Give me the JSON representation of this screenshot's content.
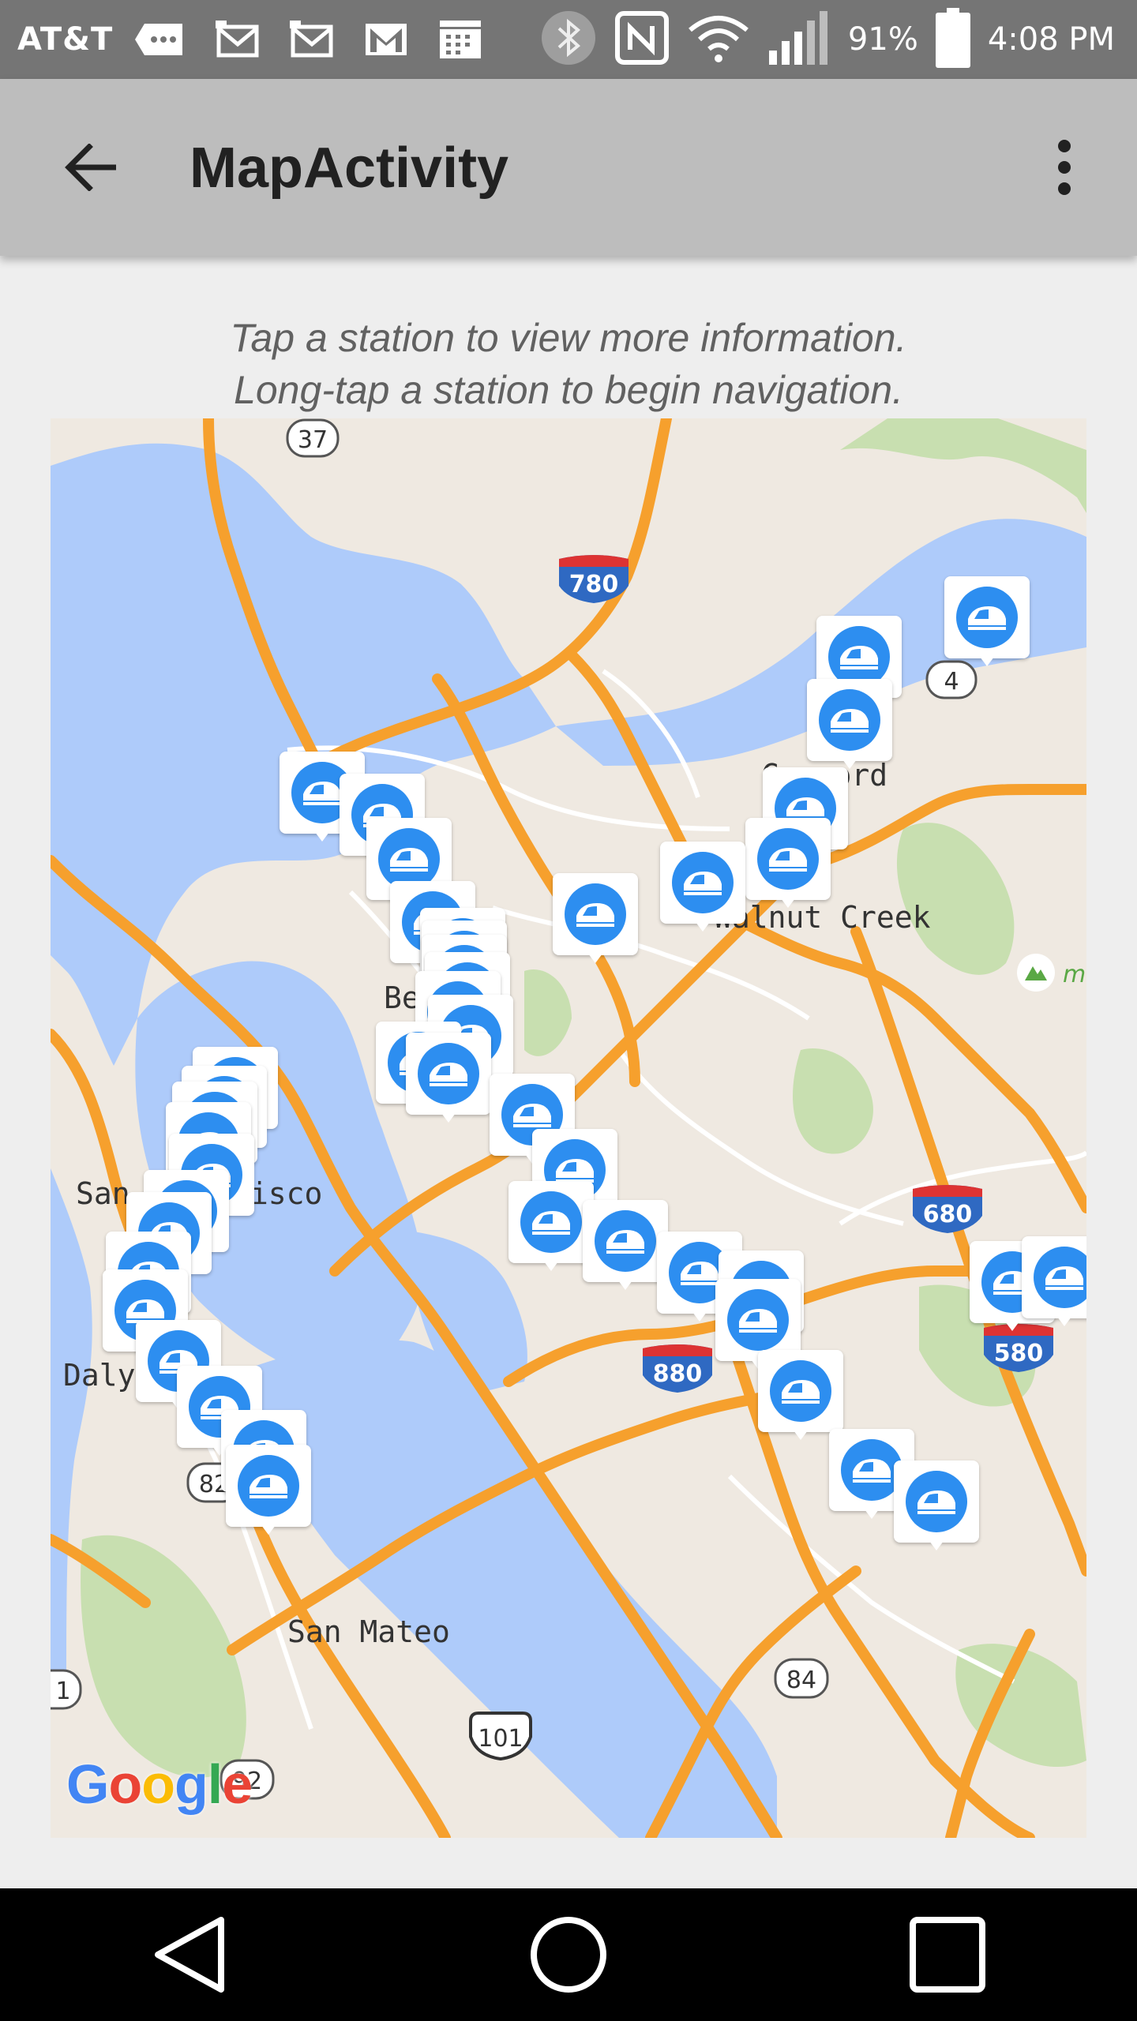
{
  "status_bar": {
    "carrier": "AT&T",
    "battery": "91%",
    "time": "4:08 PM",
    "icons": [
      "message-icon",
      "gmail-icon",
      "gmail-icon",
      "gmail-icon",
      "calendar-icon",
      "bluetooth-icon",
      "nfc-icon",
      "wifi-icon",
      "signal-icon",
      "battery-icon"
    ]
  },
  "toolbar": {
    "title": "MapActivity",
    "back_icon": "arrow-back-icon",
    "overflow_icon": "more-vert-icon"
  },
  "instructions": {
    "line1": "Tap a station to view more information.",
    "line2": "Long-tap a station to begin navigation."
  },
  "map": {
    "attribution": "Google",
    "place_labels": {
      "concord": "Concord",
      "walnut_creek": "Walnut Creek",
      "berkeley": "Be",
      "san_francisco_left": "San",
      "san_francisco_right": "cisco",
      "daly": "Daly",
      "san_mateo": "San Mateo"
    },
    "route_shields": {
      "r37": "37",
      "r780": "780",
      "r4": "4",
      "r680": "680",
      "r580": "580",
      "r880": "880",
      "r84": "84",
      "r101": "101",
      "r92": "92",
      "r82": "82",
      "r1": "1"
    },
    "marker_icon": "train-station-icon",
    "park_icon": "park-icon",
    "colors": {
      "water": "#aecbfa",
      "land": "#efe9e1",
      "park": "#c8dfb0",
      "highway": "#f6a02d",
      "marker_blue": "#2d8ef0"
    }
  },
  "nav_bar": {
    "back_icon": "nav-back-icon",
    "home_icon": "nav-home-icon",
    "recents_icon": "nav-recents-icon"
  }
}
